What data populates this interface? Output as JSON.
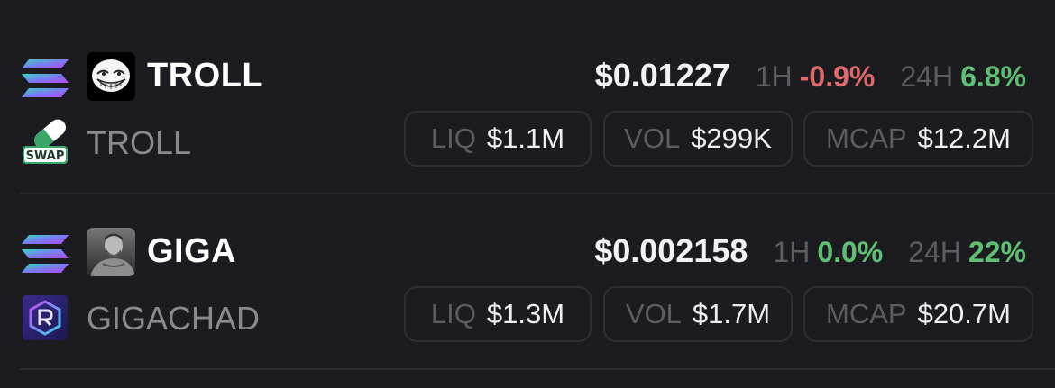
{
  "colors": {
    "background": "#1c1b20",
    "negative": "#e06a6c",
    "positive": "#5fbf72",
    "muted": "#5d5c63"
  },
  "tokens": [
    {
      "chain_icon": "solana-icon",
      "image_icon": "trollface-icon",
      "symbol": "TROLL",
      "name": "TROLL",
      "dex_icon": "swap-pill-icon",
      "dex_label": "SWAP",
      "price": "$0.01227",
      "change_1h_label": "1H",
      "change_1h": "-0.9%",
      "change_24h_label": "24H",
      "change_24h": "6.8%",
      "liq_label": "LIQ",
      "liq": "$1.1M",
      "vol_label": "VOL",
      "vol": "$299K",
      "mcap_label": "MCAP",
      "mcap": "$12.2M"
    },
    {
      "chain_icon": "solana-icon",
      "image_icon": "gigachad-avatar-icon",
      "symbol": "GIGA",
      "name": "GIGACHAD",
      "dex_icon": "raydium-icon",
      "price": "$0.002158",
      "change_1h_label": "1H",
      "change_1h": "0.0%",
      "change_24h_label": "24H",
      "change_24h": "22%",
      "liq_label": "LIQ",
      "liq": "$1.3M",
      "vol_label": "VOL",
      "vol": "$1.7M",
      "mcap_label": "MCAP",
      "mcap": "$20.7M"
    }
  ]
}
